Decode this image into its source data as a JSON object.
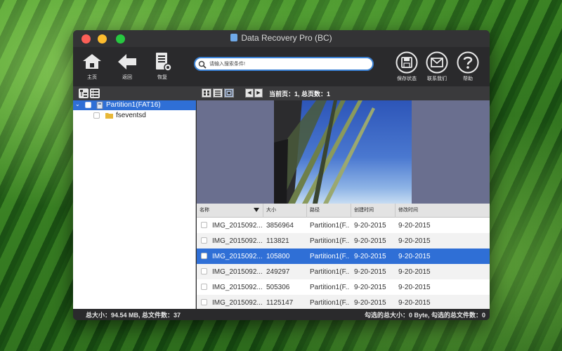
{
  "window": {
    "title": "Data Recovery Pro  (BC)"
  },
  "toolbar": {
    "home_label": "主页",
    "back_label": "返回",
    "recover_label": "恢复",
    "save_state_label": "保存状态",
    "contact_label": "联系我们",
    "help_label": "帮助"
  },
  "search": {
    "placeholder": "请输入搜索条件!",
    "value": ""
  },
  "pager": {
    "info": "当前页：1,  总页数：1"
  },
  "tree": {
    "items": [
      {
        "label": "Partition1(FAT16)",
        "selected": true
      },
      {
        "label": "fseventsd",
        "selected": false
      }
    ]
  },
  "table": {
    "headers": [
      "名称",
      "大小",
      "路径",
      "创建时间",
      "修改时间"
    ],
    "rows": [
      {
        "name": "IMG_2015092...",
        "size": "3856964",
        "path": "Partition1(F...",
        "created": "9-20-2015",
        "modified": "9-20-2015"
      },
      {
        "name": "IMG_2015092...",
        "size": "113821",
        "path": "Partition1(F...",
        "created": "9-20-2015",
        "modified": "9-20-2015"
      },
      {
        "name": "IMG_2015092...",
        "size": "105800",
        "path": "Partition1(F...",
        "created": "9-20-2015",
        "modified": "9-20-2015"
      },
      {
        "name": "IMG_2015092...",
        "size": "249297",
        "path": "Partition1(F...",
        "created": "9-20-2015",
        "modified": "9-20-2015"
      },
      {
        "name": "IMG_2015092...",
        "size": "505306",
        "path": "Partition1(F...",
        "created": "9-20-2015",
        "modified": "9-20-2015"
      },
      {
        "name": "IMG_2015092...",
        "size": "1125147",
        "path": "Partition1(F...",
        "created": "9-20-2015",
        "modified": "9-20-2015"
      }
    ],
    "selected_index": 2
  },
  "status": {
    "left": "总大小：94.54 MB,  总文件数：37",
    "right": "勾选的总大小：0 Byte,  勾选的总文件数：0"
  },
  "colors": {
    "accent": "#2f6fd6",
    "close": "#fc5f57",
    "minimize": "#fdbc2e",
    "maximize": "#27c840"
  }
}
